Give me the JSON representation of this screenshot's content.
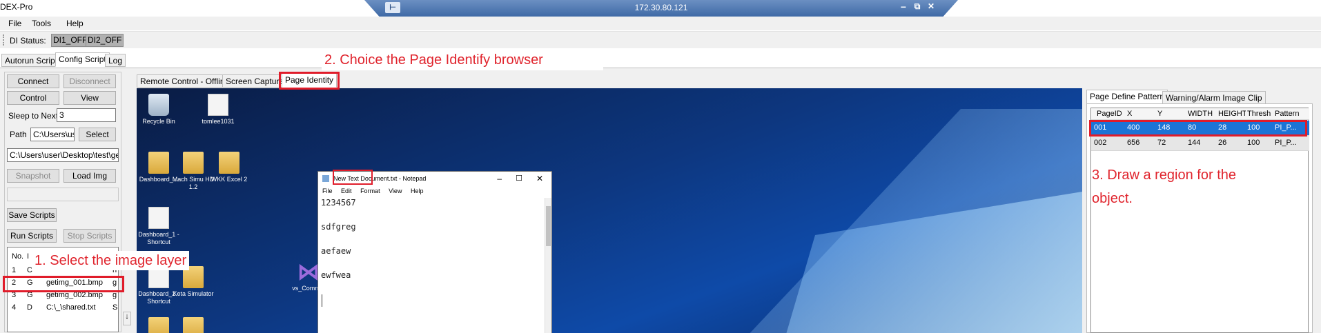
{
  "window": {
    "title": "DEX-Pro"
  },
  "rdp": {
    "ip": "172.30.80.121",
    "pin_icon": "pin-icon",
    "min": "−",
    "restore": "⧉",
    "close": "✕"
  },
  "menu": {
    "file": "File",
    "tools": "Tools",
    "help": "Help"
  },
  "toolbar": {
    "di_label": "DI Status:",
    "di1": "DI1_OFF",
    "di2": "DI2_OFF"
  },
  "main_tabs": {
    "autorun": "Autorun Script",
    "config": "Config Script",
    "log": "Log"
  },
  "left": {
    "connect": "Connect",
    "disconnect": "Disconnect",
    "control": "Control",
    "view": "View",
    "sleep_label": "Sleep to Next",
    "sleep_value": "3",
    "path_label": "Path",
    "path_value": "C:\\Users\\us",
    "select": "Select",
    "full_path": "C:\\Users\\user\\Desktop\\test\\geti",
    "snapshot": "Snapshot",
    "load_img": "Load Img",
    "save_scripts": "Save Scripts",
    "run_scripts": "Run Scripts",
    "stop_scripts": "Stop Scripts"
  },
  "script_list": {
    "headers": [
      "No.",
      "I"
    ],
    "rows": [
      {
        "no": "1",
        "type": "C",
        "name": "",
        "extra": "n"
      },
      {
        "no": "2",
        "type": "G",
        "name": "getimg_001.bmp",
        "extra": "g"
      },
      {
        "no": "3",
        "type": "G",
        "name": "getimg_002.bmp",
        "extra": "g"
      },
      {
        "no": "4",
        "type": "D",
        "name": "C:\\_\\shared.txt",
        "extra": "S"
      }
    ]
  },
  "center_tabs": {
    "remote": "Remote Control - Offline",
    "capture": "Screen Capture",
    "identity": "Page Identity"
  },
  "desktop": {
    "icons": [
      {
        "label": "Recycle Bin"
      },
      {
        "label": "tomlee1031"
      },
      {
        "label": "Dashboard_..."
      },
      {
        "label": "Mach Simu HD 1.2"
      },
      {
        "label": "WKK Excel 2"
      },
      {
        "label": "Dashboard_1 - Shortcut"
      },
      {
        "label": "Dashboard_2 - Shortcut"
      },
      {
        "label": "Kota Simulator"
      },
      {
        "label": "vs_Commu"
      }
    ],
    "notepad": {
      "title": "New Text Document.txt - Notepad",
      "menu": [
        "File",
        "Edit",
        "Format",
        "View",
        "Help"
      ],
      "lines": [
        "1234567",
        "sdfgreg",
        "aefaew",
        "ewfwea"
      ]
    }
  },
  "right": {
    "tab_pattern": "Page Define Pattern",
    "tab_alarm": "Warning/Alarm Image Clip",
    "columns": [
      "PageID",
      "X",
      "Y",
      "WIDTH",
      "HEIGHT",
      "Thresh",
      "Pattern"
    ],
    "rows": [
      [
        "001",
        "400",
        "148",
        "80",
        "28",
        "100",
        "PI_P..."
      ],
      [
        "002",
        "656",
        "72",
        "144",
        "26",
        "100",
        "PI_P..."
      ]
    ]
  },
  "annotations": {
    "step1": "1. Select the image layer",
    "step2": "2. Choice the Page Identify browser",
    "step3_line1": "3. Draw a region for the",
    "step3_line2": "object."
  }
}
